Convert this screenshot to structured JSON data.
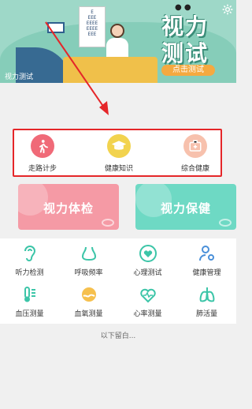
{
  "banner": {
    "title_line1": "视力",
    "title_line2": "测试",
    "start_button": "点击测试",
    "page_label": "视力测试",
    "eye_chart": "E\nEEE\nEEEE\nEEEE\nEEE"
  },
  "quick_menu": {
    "items": [
      {
        "label": "走路计步",
        "icon": "walking-person-icon",
        "color": "#f06a78"
      },
      {
        "label": "健康知识",
        "icon": "graduation-cap-icon",
        "color": "#f2d34e"
      },
      {
        "label": "综合健康",
        "icon": "medical-kit-icon",
        "color": "#f7c1ad"
      }
    ]
  },
  "cards": {
    "vision_check": {
      "label": "视力体检",
      "color": "#f59aa5"
    },
    "vision_care": {
      "label": "视力保健",
      "color": "#6ed9c4"
    }
  },
  "grid": {
    "items": [
      {
        "label": "听力检测",
        "icon": "ear-icon"
      },
      {
        "label": "呼吸频率",
        "icon": "lungs-breath-icon"
      },
      {
        "label": "心理测试",
        "icon": "heart-icon"
      },
      {
        "label": "健康管理",
        "icon": "person-gear-icon"
      },
      {
        "label": "血压测量",
        "icon": "thermometer-icon"
      },
      {
        "label": "血氧测量",
        "icon": "oxygen-icon"
      },
      {
        "label": "心率测量",
        "icon": "heart-rate-icon"
      },
      {
        "label": "肺活量",
        "icon": "lungs-icon"
      }
    ],
    "icon_color": "#3cc5a8"
  },
  "footer": {
    "text": "以下留白..."
  }
}
